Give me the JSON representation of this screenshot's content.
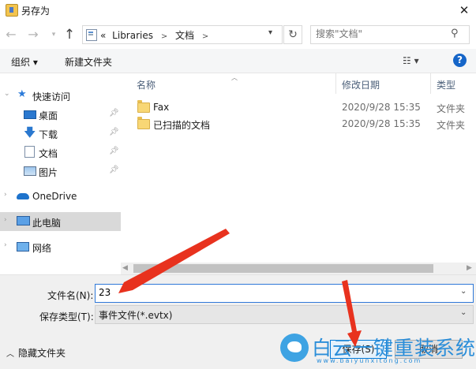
{
  "window": {
    "title": "另存为",
    "close_glyph": "✕"
  },
  "nav": {
    "address_prefix": "«",
    "address_crumbs": [
      "Libraries",
      "文档"
    ],
    "search_placeholder": "搜索\"文档\""
  },
  "toolbar": {
    "organize_label": "组织 ▾",
    "new_folder_label": "新建文件夹",
    "view_glyph": "☷ ▾",
    "help_glyph": "?"
  },
  "sidebar": {
    "items": [
      {
        "label": "快速访问",
        "icon": "star-icon",
        "pinned": false
      },
      {
        "label": "桌面",
        "icon": "desktop-icon",
        "pinned": true
      },
      {
        "label": "下载",
        "icon": "download-icon",
        "pinned": true
      },
      {
        "label": "文档",
        "icon": "document-icon",
        "pinned": true
      },
      {
        "label": "图片",
        "icon": "picture-icon",
        "pinned": true
      },
      {
        "label": "OneDrive",
        "icon": "cloud-icon",
        "pinned": false
      },
      {
        "label": "此电脑",
        "icon": "computer-icon",
        "pinned": false,
        "selected": true
      },
      {
        "label": "网络",
        "icon": "network-icon",
        "pinned": false
      }
    ]
  },
  "filelist": {
    "columns": [
      "名称",
      "修改日期",
      "类型"
    ],
    "rows": [
      {
        "name": "Fax",
        "date": "2020/9/28 15:35",
        "type": "文件夹"
      },
      {
        "name": "已扫描的文档",
        "date": "2020/9/28 15:35",
        "type": "文件夹"
      }
    ]
  },
  "form": {
    "filename_label": "文件名(N):",
    "filename_value": "23",
    "savetype_label": "保存类型(T):",
    "savetype_value": "事件文件(*.evtx)",
    "hide_folders_label": "隐藏文件夹",
    "save_label": "保存(S)",
    "cancel_label": "取消"
  },
  "watermark": {
    "text": "白云一键重装系统",
    "subtext": "www.baiyunxitong.com"
  },
  "colors": {
    "accent": "#0078d7",
    "arrow": "#e8321e",
    "selected": "#d9d9d9"
  }
}
